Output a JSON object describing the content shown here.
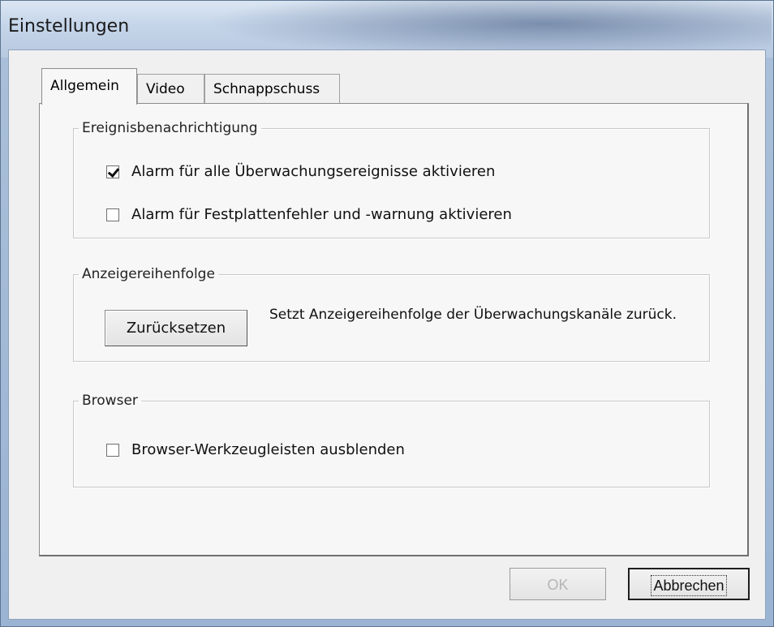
{
  "window": {
    "title": "Einstellungen"
  },
  "tabs": [
    {
      "label": "Allgemein",
      "active": true
    },
    {
      "label": "Video",
      "active": false
    },
    {
      "label": "Schnappschuss",
      "active": false
    }
  ],
  "groups": {
    "events": {
      "title": "Ereignisbenachrichtigung",
      "options": [
        {
          "label": "Alarm für alle Überwachungsereignisse aktivieren",
          "checked": true
        },
        {
          "label": "Alarm für Festplattenfehler und -warnung aktivieren",
          "checked": false
        }
      ]
    },
    "display_order": {
      "title": "Anzeigereihenfolge",
      "reset_label": "Zurücksetzen",
      "description": "Setzt Anzeigereihenfolge der Überwachungskanäle zurück."
    },
    "browser": {
      "title": "Browser",
      "option": {
        "label": "Browser-Werkzeugleisten ausblenden",
        "checked": false
      }
    }
  },
  "footer": {
    "ok_label": "OK",
    "cancel_label": "Abbrechen"
  }
}
